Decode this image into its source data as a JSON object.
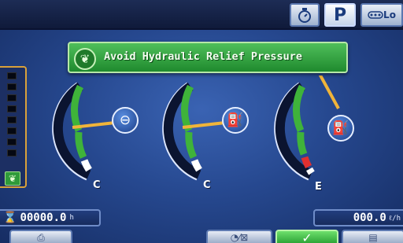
{
  "topbar": {
    "eco_icon": "eco-mode-icon",
    "park_label": "P",
    "speed_icon": "travel-speed-icon",
    "speed_label": "Lo"
  },
  "message": {
    "icon": "leaf-icon",
    "text": "Avoid Hydraulic Relief Pressure"
  },
  "gauges": [
    {
      "name": "engine-coolant-temperature",
      "icon": "coolant-temperature-icon",
      "min_label": "C",
      "level": 0.6
    },
    {
      "name": "hydraulic-oil-temperature",
      "icon": "hydraulic-oil-temperature-icon",
      "min_label": "C",
      "level": 0.6
    },
    {
      "name": "fuel-level",
      "icon": "fuel-pump-icon",
      "min_label": "E",
      "level": 0.95
    }
  ],
  "left_bar": {
    "icon": "leaf-icon",
    "segments_total": 8
  },
  "hour_meter": {
    "icon": "hourglass-icon",
    "value": "00000.0",
    "unit": "h"
  },
  "fuel_rate": {
    "value": "000.0",
    "unit": "ℓ/h"
  },
  "softkeys": [
    {
      "name": "camera",
      "icon": "camera-icon"
    },
    {
      "name": "work-mode",
      "icon": "work-mode-icon"
    },
    {
      "name": "ok",
      "icon": "checkmark-icon"
    },
    {
      "name": "menu",
      "icon": "menu-icon"
    }
  ],
  "colors": {
    "background": "#26488f",
    "banner": "#2f9b3a",
    "gauge_green": "#3fb33a",
    "gauge_white": "#ffffff",
    "gauge_red": "#e03030",
    "needle": "#f0b43a",
    "frame_amber": "#d9a13a"
  }
}
